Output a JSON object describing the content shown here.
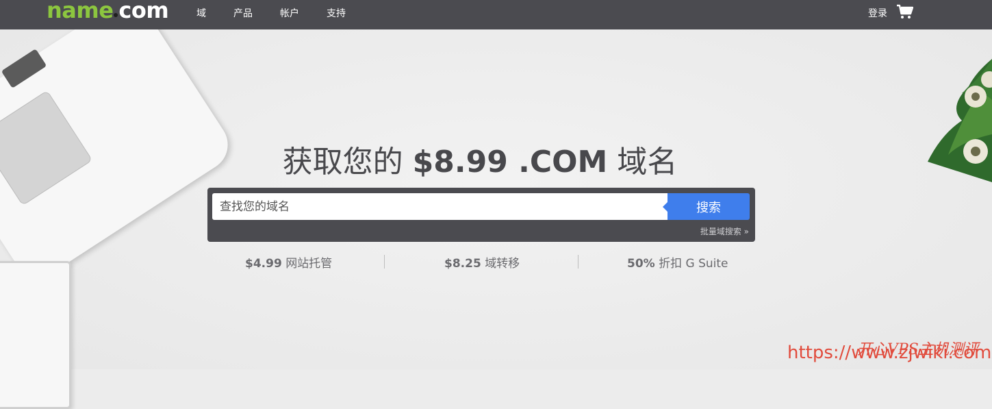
{
  "brand": {
    "logo_left": "name",
    "logo_right": "com"
  },
  "nav": {
    "items": [
      "域",
      "产品",
      "帐户",
      "支持"
    ],
    "login": "登录"
  },
  "hero": {
    "title_prefix": "获取您的",
    "title_price": "$8.99 .COM",
    "title_suffix": "域名"
  },
  "search": {
    "placeholder": "查找您的域名",
    "button": "搜索",
    "bulk": "批量域搜索 »"
  },
  "promos": [
    {
      "price": "$4.99",
      "label": "网站托管"
    },
    {
      "price": "$8.25",
      "label": "域转移"
    },
    {
      "price": "50%",
      "label": "折扣 G Suite"
    }
  ],
  "watermark": {
    "url": "https://www.zjwiki.com",
    "text": "开心VPS主机测评"
  },
  "colors": {
    "topbar": "#4b4b50",
    "accent_green": "#8cc63f",
    "button_blue": "#3f7eec"
  }
}
